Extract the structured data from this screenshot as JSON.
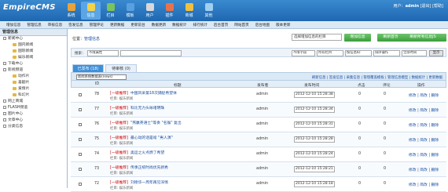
{
  "header": {
    "logo": "EmpireCMS",
    "nav": [
      {
        "label": "系统",
        "icon": "system-icon",
        "color": "#e8a33a"
      },
      {
        "label": "信息",
        "icon": "info-icon",
        "color": "#f3d34a"
      },
      {
        "label": "栏目",
        "icon": "column-icon",
        "color": "#7cc35c"
      },
      {
        "label": "模板",
        "icon": "template-icon",
        "color": "#5aa0e0"
      },
      {
        "label": "用户",
        "icon": "user-icon",
        "color": "#d8d8d8"
      },
      {
        "label": "插件",
        "icon": "plugin-icon",
        "color": "#e8734a"
      },
      {
        "label": "商城",
        "icon": "shop-icon",
        "color": "#f0c040"
      },
      {
        "label": "其他",
        "icon": "other-icon",
        "color": "#9fd0f0"
      }
    ],
    "user_label": "用户：",
    "username": "admin",
    "user_links": "[退出] [帮助]"
  },
  "subnav": [
    "增加信息",
    "管理信息",
    "审核信息",
    "签发信息",
    "管理评论",
    "更新数据",
    "更新前台",
    "数据更新",
    "数据统计",
    "排行统计",
    "后台首页",
    "网站首页",
    "后台地图",
    "版本更新"
  ],
  "sidebar": {
    "title": "管理信息",
    "tree": [
      {
        "label": "新闻中心",
        "level": 1
      },
      {
        "label": "国内新闻",
        "level": 2
      },
      {
        "label": "国际新闻",
        "level": 2
      },
      {
        "label": "娱乐新闻",
        "level": 2
      },
      {
        "label": "下载中心",
        "level": 1
      },
      {
        "label": "影视频道",
        "level": 1
      },
      {
        "label": "动作片",
        "level": 2
      },
      {
        "label": "喜剧片",
        "level": 2
      },
      {
        "label": "爱情片",
        "level": 2
      },
      {
        "label": "科幻片",
        "level": 2
      },
      {
        "label": "网上商城",
        "level": 1
      },
      {
        "label": "FLASH频道",
        "level": 1
      },
      {
        "label": "图片中心",
        "level": 1
      },
      {
        "label": "文章中心",
        "level": 1
      },
      {
        "label": "分类信息",
        "level": 1
      }
    ]
  },
  "breadcrumb": {
    "label": "位置：",
    "link": "管理信息"
  },
  "column_select": "选择增加信息的栏目",
  "buttons": {
    "add": "增加信息",
    "refresh_home": "刷新首页",
    "refresh_all": "刷新所有信息JS"
  },
  "search": {
    "label": "搜索：",
    "field1": "不限属性",
    "keyword_placeholder": "",
    "field2": "不限字段",
    "field3": "所有栏目",
    "field4": "按信息ID",
    "field5": "排序操作",
    "field6": "全部时间",
    "button": "显示"
  },
  "tabs": [
    "已发布 (18)",
    "待审核 (0)"
  ],
  "list_select": "新闻系统数据表(news)",
  "quick_links": "刷新信息 | 签发信息 | 采集信息 | 管理覆盖模板 | 管理信息模型 | 数据统计 | 更新数据",
  "table": {
    "headers": [
      "ID",
      "标题",
      "发布者",
      "发布时间",
      "点击",
      "评论",
      "操作"
    ],
    "rows": [
      {
        "id": "78",
        "rec": "[一级推荐]",
        "title": "中国风采第18次捕捉希望体",
        "col": "栏目: 娱乐新闻",
        "user": "admin",
        "time": "2012-12-10 15:28:38",
        "hits": "0",
        "comments": "0",
        "ops": "修改 | 简改 | 删除"
      },
      {
        "id": "77",
        "rec": "[一级推荐]",
        "title": "科比无力头咏诸明珠",
        "col": "栏目: 娱乐新闻",
        "user": "admin",
        "time": "2012-12-10 15:28:34",
        "hits": "0",
        "comments": "0",
        "ops": "修改 | 简改 | 删除"
      },
      {
        "id": "76",
        "rec": "[一级推荐]",
        "title": "\"燕赢英语士\"等奏 \"名猴\" 复出",
        "col": "栏目: 娱乐新闻",
        "user": "admin",
        "time": "2012-12-10 15:28:31",
        "hits": "0",
        "comments": "0",
        "ops": "修改 | 简改 | 删除"
      },
      {
        "id": "75",
        "rec": "[一级推荐]",
        "title": "最心动的话是啥 \"男人演\"",
        "col": "栏目: 娱乐新闻",
        "user": "admin",
        "time": "2012-12-10 15:28:28",
        "hits": "0",
        "comments": "0",
        "ops": "修改 | 简改 | 删除"
      },
      {
        "id": "74",
        "rec": "[一级推荐]",
        "title": "奥运之火点燃了希望",
        "col": "栏目: 娱乐新闻",
        "user": "admin",
        "time": "2012-12-10 15:28:24",
        "hits": "0",
        "comments": "0",
        "ops": "修改 | 简改 | 删除"
      },
      {
        "id": "73",
        "rec": "[一级推荐]",
        "title": "传承正统时尚优先新秀",
        "col": "栏目: 娱乐新闻",
        "user": "admin",
        "time": "2012-12-10 15:28:21",
        "hits": "0",
        "comments": "0",
        "ops": "修改 | 简改 | 删除"
      },
      {
        "id": "72",
        "rec": "[一级推荐]",
        "title": "刘德华一周年再见深情",
        "col": "栏目: 娱乐新闻",
        "user": "admin",
        "time": "2012-12-10 15:28:18",
        "hits": "0",
        "comments": "0",
        "ops": "修改 | 简改 | 删除"
      }
    ]
  }
}
